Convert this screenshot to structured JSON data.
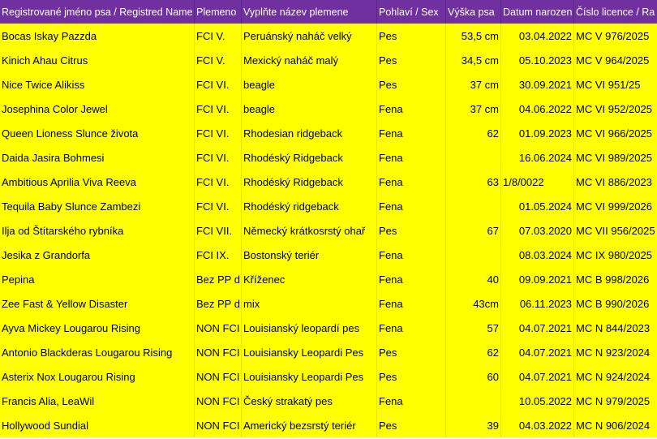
{
  "header": {
    "col_name": "Registrované jméno psa / Registred Name",
    "col_fci": "Plemeno",
    "col_breed": "Vyplňte název plemene",
    "col_sex": "Pohlaví / Sex",
    "col_height": "Výška psa",
    "col_date": "Datum narozen",
    "col_license": "Číslo licence / Ra"
  },
  "rows": [
    {
      "name": "Bocas Iskay Pazzda",
      "fci": "FCI V.",
      "breed": "Peruánský naháč velký",
      "sex": "Pes",
      "height": "53,5 cm",
      "date": "03.04.2022",
      "license": "MC V 976/2025"
    },
    {
      "name": "Kinich Ahau Citrus",
      "fci": "FCI V.",
      "breed": "Mexický naháč malý",
      "sex": "Pes",
      "height": "34,5 cm",
      "date": "05.10.2023",
      "license": "MC V 964/2025"
    },
    {
      "name": "Nice Twice Alikiss",
      "fci": "FCI VI.",
      "breed": "beagle",
      "sex": "Pes",
      "height": "37 cm",
      "date": "30.09.2021",
      "license": "MC VI 951/25"
    },
    {
      "name": "Josephina Color Jewel",
      "fci": "FCI VI.",
      "breed": "beagle",
      "sex": "Fena",
      "height": "37 cm",
      "date": "04.06.2022",
      "license": "MC VI 952/2025"
    },
    {
      "name": "Queen Lioness Slunce života",
      "fci": "FCI VI.",
      "breed": "Rhodesian ridgeback",
      "sex": "Fena",
      "height": "62",
      "date": "01.09.2023",
      "license": "MC VI 966/2025"
    },
    {
      "name": "Daida Jasira Bohmesi",
      "fci": "FCI VI.",
      "breed": "Rhodéský Ridgeback",
      "sex": "Fena",
      "height": "",
      "date": "16.06.2024",
      "license": "MC VI 989/2025"
    },
    {
      "name": "Ambitious Aprilia Viva Reeva",
      "fci": "FCI VI.",
      "breed": "Rhodéský Ridgeback",
      "sex": "Fena",
      "height": "63",
      "date": "1/8/0022",
      "date_left": true,
      "license": "MC VI 886/2023"
    },
    {
      "name": "Tequila Baby Slunce Zambezi",
      "fci": "FCI VI.",
      "breed": "Rhodéský ridgeback",
      "sex": "Fena",
      "height": "",
      "date": "01.05.2024",
      "license": "MC VI 999/2026"
    },
    {
      "name": "Ilja od Štítarského rybníka",
      "fci": "FCI VII.",
      "breed": "Německý krátkosrstý ohař",
      "sex": "Pes",
      "height": "67",
      "date": "07.03.2020",
      "license": "MC VII 956/2025"
    },
    {
      "name": "Jesika z Grandorfa",
      "fci": "FCI IX.",
      "breed": "Bostonský teriér",
      "sex": "Fena",
      "height": "",
      "date": "08.03.2024",
      "license": "MC IX 980/2025"
    },
    {
      "name": "Pepina",
      "fci": "Bez PP d",
      "breed": "Kříženec",
      "sex": "Fena",
      "height": "40",
      "date": "09.09.2021",
      "license": "MC B 998/2026"
    },
    {
      "name": "Zee Fast & Yellow Disaster",
      "fci": "Bez PP d",
      "breed": "mix",
      "sex": "Fena",
      "height": "43cm",
      "date": "06.11.2023",
      "license": "MC B 990/2026"
    },
    {
      "name": "Ayva Mickey Lougarou Rising",
      "fci": "NON FCI",
      "breed": "Louisianský leopardí pes",
      "sex": "Fena",
      "height": "57",
      "date": "04.07.2021",
      "license": "MC N 844/2023"
    },
    {
      "name": "Antonio Blackderas Lougarou Rising",
      "fci": "NON FCI",
      "breed": "Louisiansky Leopardi Pes",
      "sex": "Pes",
      "height": "62",
      "date": "04.07.2021",
      "license": "MC N 923/2024"
    },
    {
      "name": "Asterix Nox Lougarou Rising",
      "fci": "NON FCI",
      "breed": "Louisiansky Leopardi Pes",
      "sex": "Pes",
      "height": "60",
      "date": "04.07.2021",
      "license": "MC N 924/2024"
    },
    {
      "name": "Francis Alia, LeaWil",
      "fci": "NON FCI",
      "breed": "Český strakatý pes",
      "sex": "Fena",
      "height": "",
      "date": "10.05.2022",
      "license": "MC N 979/2025"
    },
    {
      "name": "Hollywood Sundial",
      "fci": "NON FCI",
      "breed": "Americký bezsrstý teriér",
      "sex": "Pes",
      "height": "39",
      "date": "04.03.2022",
      "license": "MC N 906/2024"
    }
  ]
}
